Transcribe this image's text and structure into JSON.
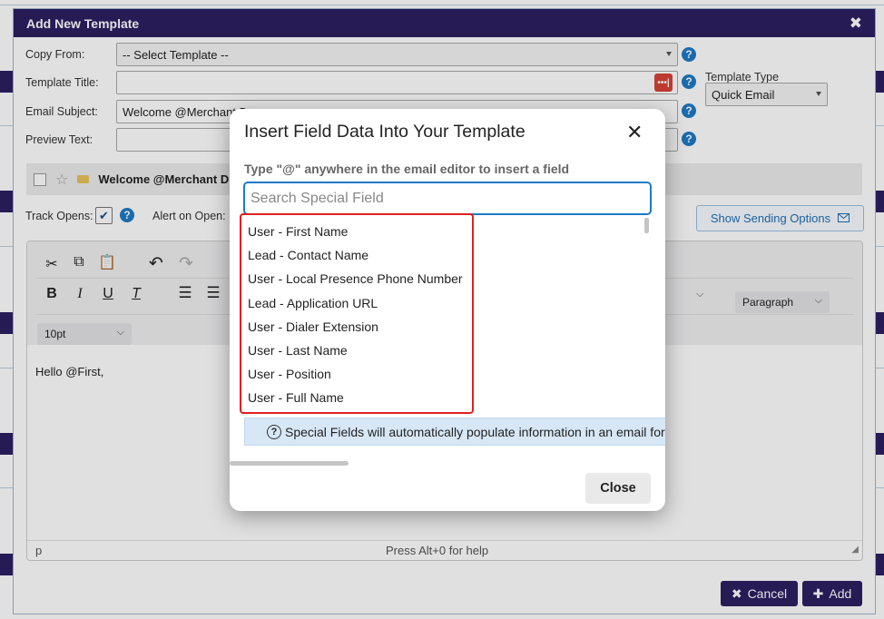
{
  "dialog": {
    "title": "Add New Template",
    "close_glyph": "✖",
    "copy_from_label": "Copy From:",
    "copy_from_value": "-- Select Template --",
    "template_title_label": "Template Title:",
    "template_title_value": "",
    "template_type_label": "Template Type",
    "template_type_value": "Quick Email",
    "email_subject_label": "Email Subject:",
    "email_subject_value": "Welcome @Merchant D",
    "preview_text_label": "Preview Text:",
    "preview_text_value": "",
    "preview_sender": "Welcome @Merchant D",
    "track_opens_label": "Track Opens:",
    "alert_on_open_label": "Alert on Open:",
    "show_sending_label": "Show Sending Options",
    "help_glyph": "?"
  },
  "editor": {
    "paragraph_label": "Paragraph",
    "font_size_label": "10pt",
    "body_text": "Hello @First,",
    "status_path": "p",
    "status_help": "Press Alt+0 for help"
  },
  "footer": {
    "cancel_label": "Cancel",
    "add_label": "Add"
  },
  "modal": {
    "title": "Insert Field Data Into Your Template",
    "close_glyph": "✕",
    "hint": "Type \"@\" anywhere in the email editor to insert a field",
    "search_placeholder": "Search Special Field",
    "items": [
      "User - First Name",
      "Lead - Contact Name",
      "User - Local Presence Phone Number",
      "Lead - Application URL",
      "User - Dialer Extension",
      "User - Last Name",
      "User - Position",
      "User - Full Name"
    ],
    "info_text": "Special Fields will automatically populate information in an email for",
    "close_label": "Close"
  },
  "icons": {
    "scissors": "scissors-icon",
    "copy": "copy-icon",
    "paste": "paste-icon",
    "undo": "undo-icon",
    "redo": "redo-icon",
    "bold": "bold-icon",
    "italic": "italic-icon",
    "underline": "underline-icon",
    "clear-format": "clear-format-icon",
    "ordered-list": "ordered-list-icon",
    "unordered-list": "unordered-list-icon",
    "envelope": "envelope-icon",
    "star": "star-icon",
    "tag": "tag-icon",
    "password": "password-icon",
    "question": "question-icon"
  },
  "colors": {
    "header": "#2d1f62",
    "accent": "#1e7ac7",
    "highlight": "#e02020",
    "info_bg": "#d7e7f6"
  }
}
